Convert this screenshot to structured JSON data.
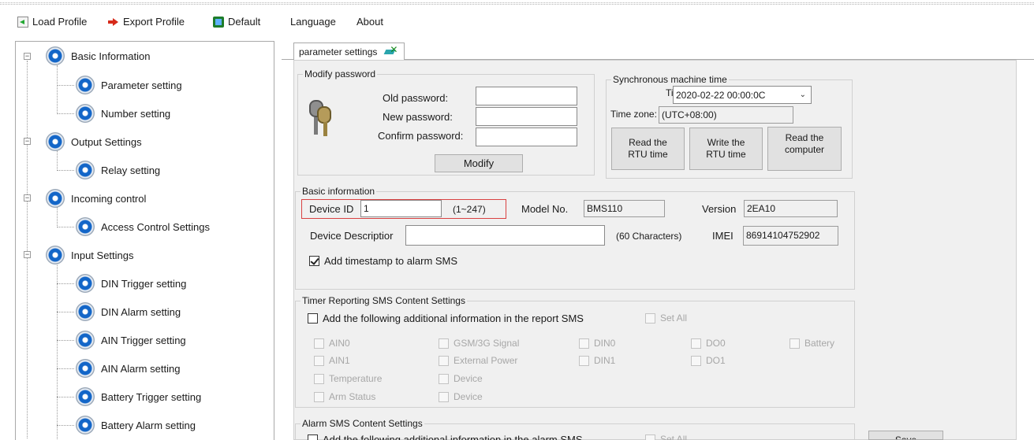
{
  "menubar": {
    "load_profile": "Load Profile",
    "export_profile": "Export Profile",
    "default": "Default",
    "language": "Language",
    "about": "About"
  },
  "tree": {
    "nodes": [
      {
        "label": "Basic Information"
      },
      {
        "label": "Parameter setting"
      },
      {
        "label": "Number setting"
      },
      {
        "label": "Output Settings"
      },
      {
        "label": "Relay setting"
      },
      {
        "label": "Incoming control"
      },
      {
        "label": "Access Control Settings"
      },
      {
        "label": "Input Settings"
      },
      {
        "label": "DIN Trigger setting"
      },
      {
        "label": "DIN Alarm setting"
      },
      {
        "label": "AIN Trigger setting"
      },
      {
        "label": "AIN Alarm setting"
      },
      {
        "label": "Battery Trigger setting"
      },
      {
        "label": "Battery Alarm setting"
      }
    ]
  },
  "tab": {
    "label": "parameter settings"
  },
  "password": {
    "legend": "Modify password",
    "old_label": "Old password:",
    "new_label": "New password:",
    "confirm_label": "Confirm password:",
    "old_value": "",
    "new_value": "",
    "confirm_value": "",
    "modify_button": "Modify"
  },
  "time_sync": {
    "legend": "Synchronous machine time",
    "time_label": "Time:",
    "time_value": "2020-02-22 00:00:0C",
    "timezone_label": "Time zone:",
    "timezone_value": "(UTC+08:00)",
    "read_rtu_line1": "Read the",
    "read_rtu_line2": "RTU time",
    "write_rtu_line1": "Write the",
    "write_rtu_line2": "RTU time",
    "read_computer_line1": "Read the",
    "read_computer_line2": "computer"
  },
  "basic": {
    "legend": "Basic information",
    "device_id_label": "Device ID",
    "device_id_value": "1",
    "device_id_range": "(1~247)",
    "model_label": "Model No.",
    "model_value": "BMS110",
    "version_label": "Version",
    "version_value": "2EA10",
    "desc_label": "Device Descriptior",
    "desc_value": "",
    "desc_hint": "(60 Characters)",
    "imei_label": "IMEI",
    "imei_value": "86914104752902",
    "timestamp_label": "Add timestamp to alarm SMS",
    "timestamp_checked": true
  },
  "timer_sms": {
    "legend": "Timer Reporting SMS Content Settings",
    "add_label": "Add the following additional information in the report SMS",
    "set_all": "Set All",
    "options": [
      "AIN0",
      "GSM/3G Signal",
      "DIN0",
      "DO0",
      "Battery",
      "AIN1",
      "External Power",
      "DIN1",
      "DO1",
      "Temperature",
      "Device",
      "Arm Status",
      "Device"
    ]
  },
  "alarm_sms": {
    "legend": "Alarm SMS Content Settings",
    "add_label": "Add the following additional information in the alarm SMS",
    "set_all": "Set All"
  },
  "save_button": "Save"
}
